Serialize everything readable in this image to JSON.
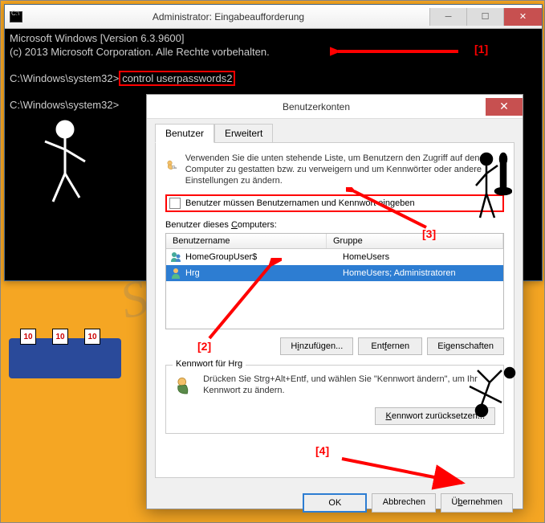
{
  "cmd": {
    "title": "Administrator: Eingabeaufforderung",
    "line1": "Microsoft Windows [Version 6.3.9600]",
    "line2": "(c) 2013 Microsoft Corporation. Alle Rechte vorbehalten.",
    "prompt1": "C:\\Windows\\system32>",
    "command": "control userpasswords2",
    "prompt2": "C:\\Windows\\system32>"
  },
  "dlg": {
    "title": "Benutzerkonten",
    "tabs": {
      "users": "Benutzer",
      "advanced": "Erweitert"
    },
    "info_text": "Verwenden Sie die unten stehende Liste, um Benutzern den Zugriff auf den Computer zu gestatten bzw. zu verweigern und um Kennwörter oder andere Einstellungen zu ändern.",
    "checkbox_label": "Benutzer müssen Benutzernamen und Kennwort eingeben",
    "list_label_pre": "Benutzer dieses ",
    "list_label_u": "C",
    "list_label_post": "omputers:",
    "col_name": "Benutzername",
    "col_group": "Gruppe",
    "rows": [
      {
        "name": "HomeGroupUser$",
        "group": "HomeUsers"
      },
      {
        "name": "Hrg",
        "group": "HomeUsers; Administratoren"
      }
    ],
    "btn_add_pre": "H",
    "btn_add_u": "i",
    "btn_add_post": "nzufügen...",
    "btn_remove_pre": "Ent",
    "btn_remove_u": "f",
    "btn_remove_post": "ernen",
    "btn_props_pre": "Ei",
    "btn_props_u": "g",
    "btn_props_post": "enschaften",
    "group_title": "Kennwort für Hrg",
    "group_text": "Drücken Sie Strg+Alt+Entf, und wählen Sie \"Kennwort ändern\", um Ihr Kennwort zu ändern.",
    "btn_reset_pre": "",
    "btn_reset_u": "K",
    "btn_reset_post": "ennwort zurücksetzen...",
    "btn_ok": "OK",
    "btn_cancel": "Abbrechen",
    "btn_apply_pre": "Ü",
    "btn_apply_u": "b",
    "btn_apply_post": "ernehmen"
  },
  "annotations": {
    "a1": "[1]",
    "a2": "[2]",
    "a3": "[3]",
    "a4": "[4]"
  },
  "watermark": "SoftwareOK.de",
  "judges": [
    "10",
    "10",
    "10"
  ]
}
